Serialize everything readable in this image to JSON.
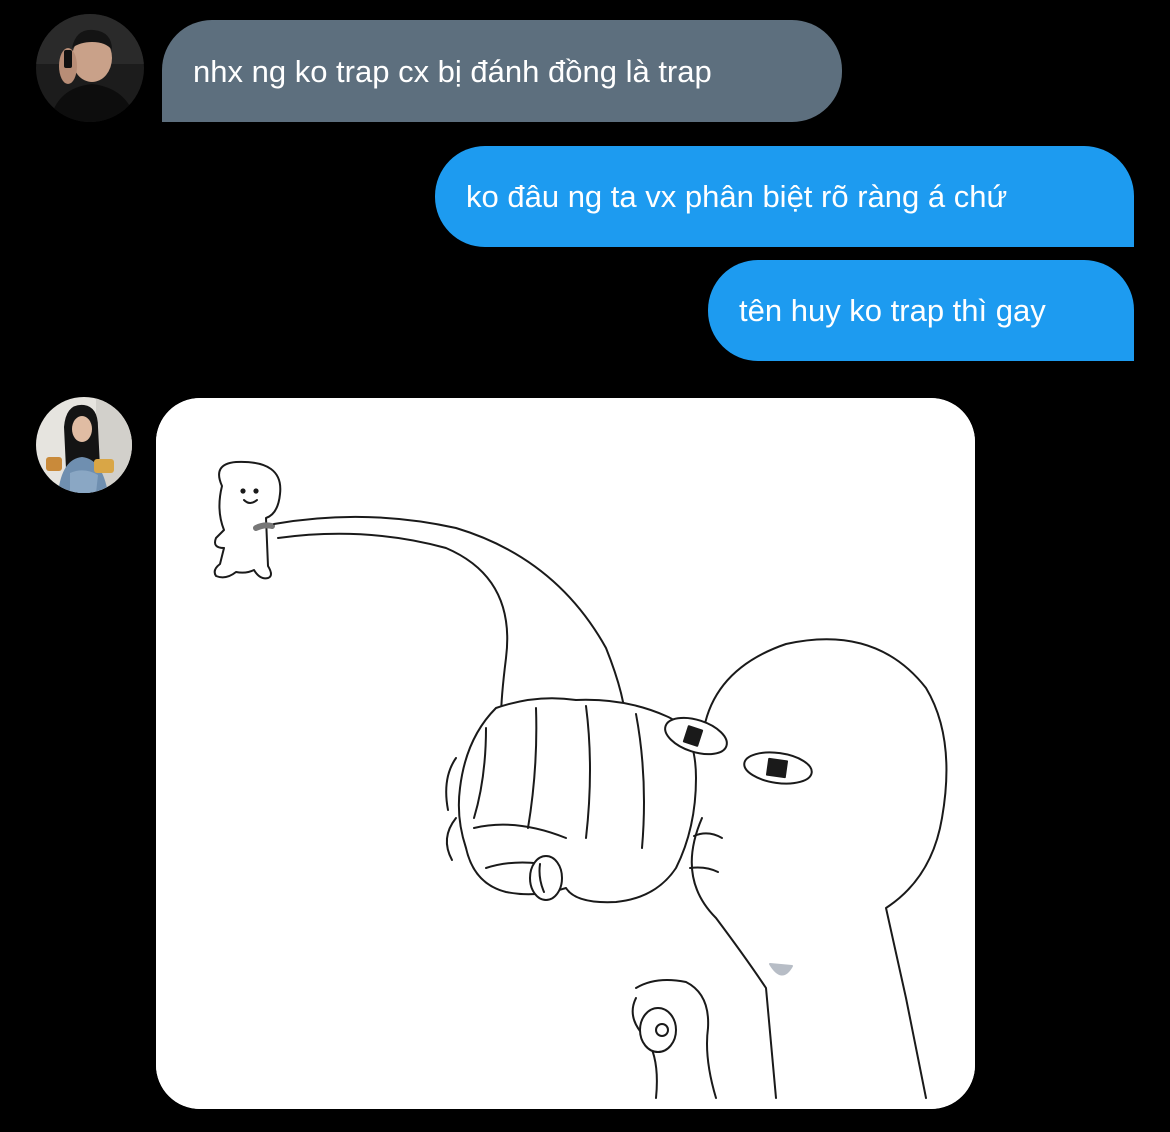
{
  "conversation": {
    "messages": [
      {
        "sender": "other-1",
        "direction": "incoming",
        "type": "text",
        "text": "nhx ng ko trap cx bị đánh đồng là trap"
      },
      {
        "sender": "me",
        "direction": "outgoing",
        "type": "text",
        "text": "ko đâu ng ta vx phân biệt rõ ràng á chứ"
      },
      {
        "sender": "me",
        "direction": "outgoing",
        "type": "text",
        "text": "tên huy ko trap thì gay"
      },
      {
        "sender": "other-2",
        "direction": "incoming",
        "type": "image",
        "image_subject": "cartoon-punch-meme"
      }
    ]
  },
  "colors": {
    "background": "#000000",
    "incoming_bubble": "#5d6f7e",
    "outgoing_bubble": "#1d9bf0",
    "text": "#ffffff"
  }
}
